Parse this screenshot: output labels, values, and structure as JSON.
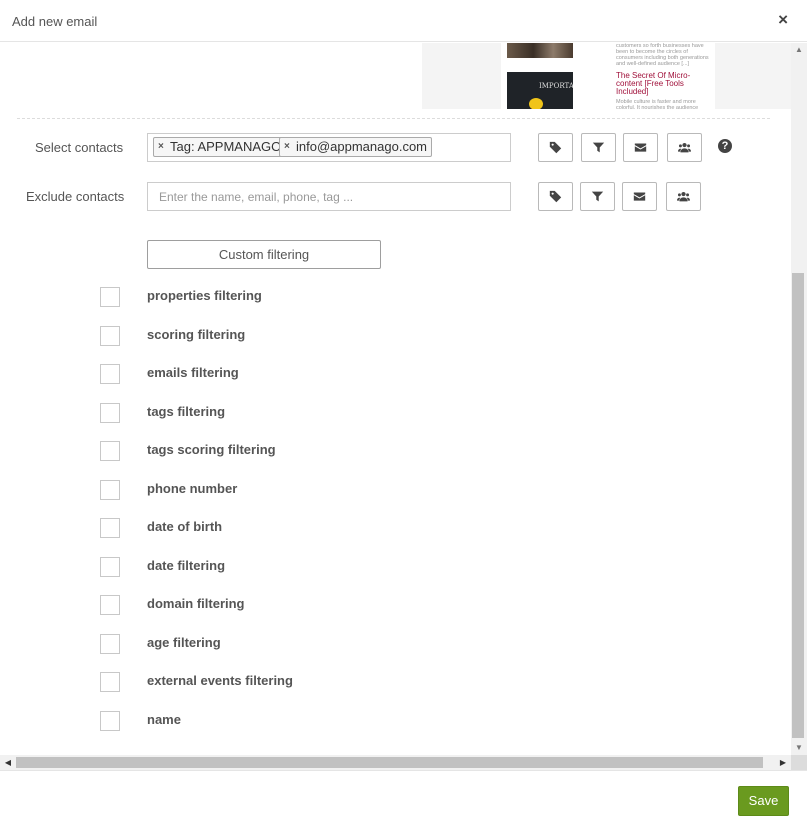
{
  "modal": {
    "title": "Add new email",
    "close_glyph": "×"
  },
  "preview": {
    "snippet_top": "customers so forth businesses have been to become the circles of consumers including both generations and well-defined audience [...]",
    "article_title": "The Secret Of Micro-content [Free Tools Included]",
    "article_snippet": "Mobile culture is faster and more colorful. It nourishes the audience",
    "thumb_word": "IMPORTANT"
  },
  "select_contacts": {
    "label": "Select contacts",
    "tokens": [
      {
        "text": "Tag: APPMANAGO",
        "remove": "×"
      },
      {
        "text": "info@appmanago.com",
        "remove": "×"
      }
    ],
    "help": "?"
  },
  "exclude_contacts": {
    "label": "Exclude contacts",
    "placeholder": "Enter the name, email, phone, tag ..."
  },
  "icon_buttons": [
    "tag-icon",
    "filter-icon",
    "envelope-icon",
    "users-icon"
  ],
  "custom_filtering": {
    "label": "Custom filtering"
  },
  "filters": [
    "properties filtering",
    "scoring filtering",
    "emails filtering",
    "tags filtering",
    "tags scoring filtering",
    "phone number",
    "date of birth",
    "date filtering",
    "domain filtering",
    "age filtering",
    "external events filtering",
    "name"
  ],
  "scrollbar": {
    "up": "▲",
    "down": "▼",
    "left": "◀",
    "right": "▶"
  },
  "footer": {
    "save_label": "Save"
  },
  "colors": {
    "accent_green": "#6a9a1f",
    "article_title": "#a0103a"
  }
}
